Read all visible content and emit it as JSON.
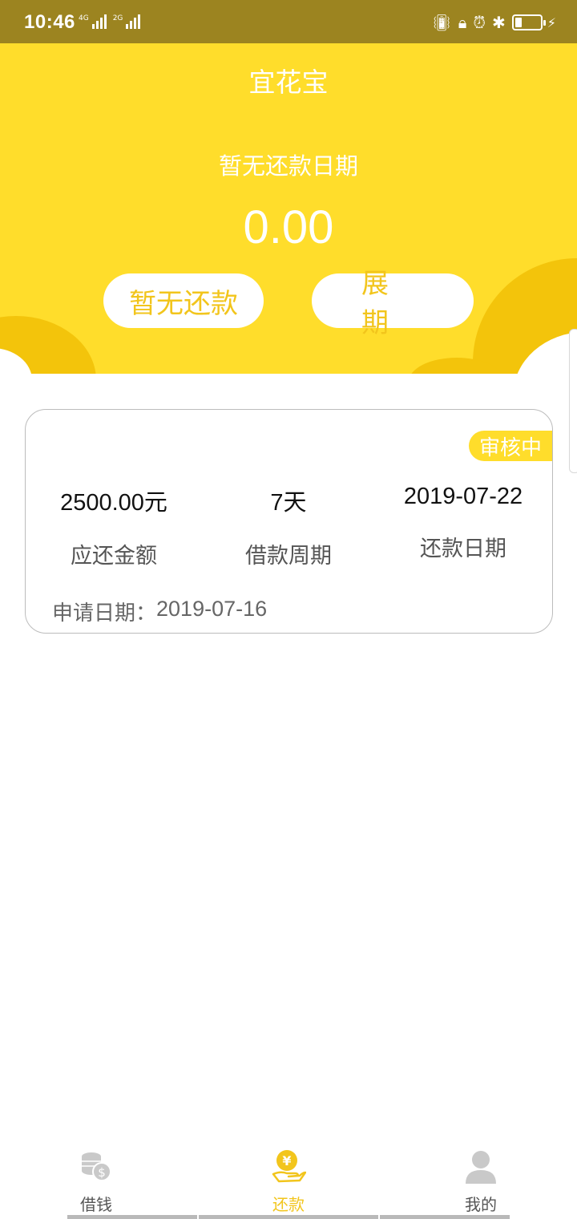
{
  "status_bar": {
    "time": "10:46",
    "net1": "4G",
    "net2": "2G",
    "icons": [
      "vibrate-icon",
      "lock-rotation-icon",
      "alarm-icon",
      "bluetooth-icon",
      "battery-icon",
      "charging-icon"
    ]
  },
  "header": {
    "title": "宜花宝",
    "repay_date_label": "暂无还款日期",
    "repay_amount": "0.00",
    "no_repay_button": "暂无还款",
    "extend_button": "展期",
    "bg_color": "#ffdd2b",
    "accent_color": "#f2c51c"
  },
  "loan_card": {
    "status_badge": "审核中",
    "amount_value": "2500.00元",
    "amount_label": "应还金额",
    "period_value": "7天",
    "period_label": "借款周期",
    "due_date_value": "2019-07-22",
    "due_date_label": "还款日期",
    "apply_label": "申请日期：",
    "apply_date": "2019-07-16"
  },
  "bottom_nav": {
    "tabs": [
      {
        "label": "借钱",
        "icon": "coins-icon",
        "active": false
      },
      {
        "label": "还款",
        "icon": "yen-hand-icon",
        "active": true
      },
      {
        "label": "我的",
        "icon": "user-icon",
        "active": false
      }
    ]
  }
}
